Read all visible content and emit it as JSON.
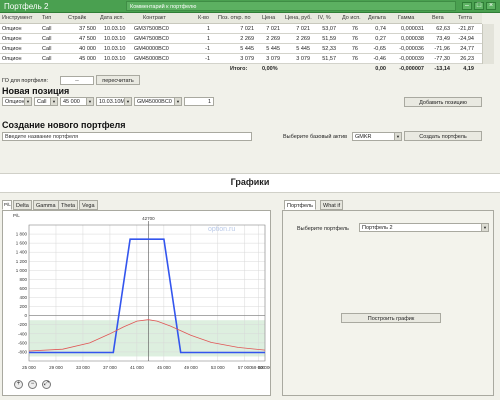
{
  "window": {
    "title": "Портфель 2",
    "comment_placeholder": "Комментарий к портфелю",
    "btn_min": "–",
    "btn_max": "□",
    "btn_close": "×"
  },
  "table": {
    "headers": [
      "Инструмент",
      "Тип",
      "Страйк",
      "Дата исп.",
      "Контракт",
      "К-во",
      "Поз. откр. по",
      "Цена",
      "Цена, руб.",
      "IV, %",
      "До исп.",
      "Дельта",
      "Гамма",
      "Вега",
      "Тетта"
    ],
    "rows": [
      [
        "Опцион",
        "Call",
        "37 500",
        "10.03.10",
        "GM37500BC0",
        "1",
        "7 021",
        "7 021",
        "7 021",
        "53,07",
        "76",
        "0,74",
        "0,000031",
        "62,63",
        "-21,87"
      ],
      [
        "Опцион",
        "Call",
        "47 500",
        "10.03.10",
        "GM47500BC0",
        "1",
        "2 269",
        "2 269",
        "2 269",
        "51,59",
        "76",
        "0,27",
        "0,000038",
        "73,49",
        "-24,94"
      ],
      [
        "Опцион",
        "Call",
        "40 000",
        "10.03.10",
        "GM40000BC0",
        "-1",
        "5 445",
        "5 445",
        "5 445",
        "52,33",
        "76",
        "-0,65",
        "-0,000036",
        "-71,96",
        "24,77"
      ],
      [
        "Опцион",
        "Call",
        "45 000",
        "10.03.10",
        "GM45000BC0",
        "-1",
        "3 079",
        "3 079",
        "3 079",
        "51,57",
        "76",
        "-0,46",
        "-0,000039",
        "-77,30",
        "26,23"
      ]
    ],
    "remove_icon": "✕",
    "totals": {
      "label": "Итого:",
      "pct": "0,00%",
      "delta": "0,00",
      "gamma": "-0,000007",
      "vega": "-13,14",
      "theta": "4,19"
    }
  },
  "go": {
    "label": "ГО для портфеля:",
    "value": "--",
    "recalc_button": "пересчитать"
  },
  "new_position": {
    "title": "Новая позиция",
    "instrument": "Опцион",
    "type": "Call",
    "strike": "45 000",
    "date": "10.03.10M",
    "contract": "GM45000BC0",
    "qty": "1",
    "add_button": "Добавить позицию"
  },
  "new_portfolio": {
    "title": "Создание нового портфеля",
    "name_placeholder": "Введите название портфеля",
    "base_label": "Выберите базовый актив",
    "base_value": "GMKR",
    "create_button": "Создать портфель"
  },
  "graphs": {
    "title": "Графики",
    "tabs": [
      "P/L",
      "Delta",
      "Gamma",
      "Theta",
      "Vega"
    ],
    "right_tabs": [
      "Портфель",
      "What if"
    ],
    "portfolio_label": "Выберите портфель",
    "portfolio_value": "Портфель 2",
    "build_button": "Построить график",
    "watermark": "option.ru",
    "zoom_in": "+",
    "zoom_out": "−",
    "zoom_fit": "⤢"
  },
  "chart_data": {
    "type": "line",
    "ylabel": "P/L",
    "marker_label": "42700",
    "marker_x": 42700,
    "xlim": [
      25000,
      60000
    ],
    "ylim": [
      -1000,
      2000
    ],
    "x_ticks": [
      "25 000",
      "29 000",
      "33 000",
      "37 000",
      "41 000",
      "45 000",
      "49 000",
      "53 000",
      "57 000",
      "59 000",
      "60 000"
    ],
    "y_ticks": [
      "1 800",
      "1 600",
      "1 400",
      "1 200",
      "1 000",
      "800",
      "600",
      "400",
      "200",
      "0",
      "-200",
      "-400",
      "-600",
      "-800"
    ],
    "series": [
      {
        "color": "#3355ee",
        "x": [
          25000,
          37500,
          40000,
          45000,
          47500,
          60000
        ],
        "y": [
          -813,
          -813,
          1687,
          1687,
          -813,
          -813
        ]
      },
      {
        "color": "#e05555",
        "x": [
          25000,
          30000,
          34000,
          37000,
          39000,
          41000,
          42700,
          44000,
          46000,
          49000,
          52000,
          56000,
          60000
        ],
        "y": [
          -780,
          -740,
          -600,
          -400,
          -250,
          -120,
          -90,
          -120,
          -230,
          -430,
          -590,
          -700,
          -760
        ]
      }
    ],
    "band_color": "#cfe8d2",
    "grid": true
  }
}
